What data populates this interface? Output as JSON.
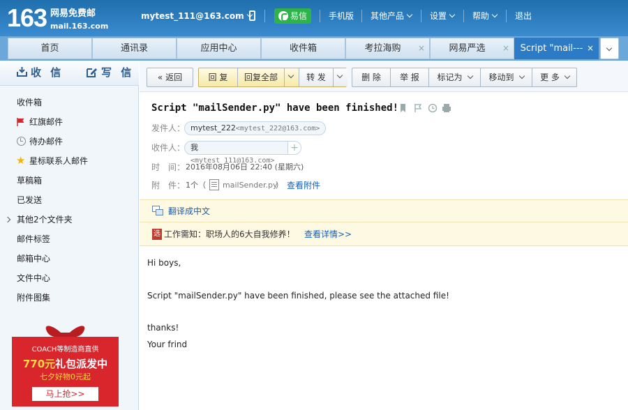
{
  "header": {
    "logo_number": "163",
    "logo_name": "网易免费邮",
    "logo_url": "mail.163.com",
    "account": "mytest_111@163.com",
    "yixin_label": "易信",
    "links": [
      "手机版",
      "其他产品",
      "设置",
      "帮助",
      "退出"
    ]
  },
  "tabs": [
    {
      "label": "首页",
      "closable": false,
      "active": false
    },
    {
      "label": "通讯录",
      "closable": false,
      "active": false
    },
    {
      "label": "应用中心",
      "closable": false,
      "active": false
    },
    {
      "label": "收件箱",
      "closable": false,
      "active": false
    },
    {
      "label": "考拉海购",
      "closable": true,
      "active": false
    },
    {
      "label": "网易严选",
      "closable": true,
      "active": false
    },
    {
      "label": "Script \"mail---",
      "closable": true,
      "active": true
    }
  ],
  "tab_close_glyph": "×",
  "sidebar": {
    "receive_label": "收 信",
    "write_label": "写 信",
    "items": [
      "收件箱",
      "红旗邮件",
      "待办邮件",
      "星标联系人邮件",
      "草稿箱",
      "已发送",
      "其他2个文件夹",
      "邮件标签",
      "邮箱中心",
      "文件中心",
      "附件图集"
    ]
  },
  "sidebar_ad": {
    "line1": "COACH等制造商直供",
    "amount": "770元",
    "line2_rest": "礼包派发中",
    "line3": "七夕好物0元起",
    "button": "马上抢>>"
  },
  "toolbar": {
    "back": "返回",
    "reply": "回 复",
    "reply_all": "回复全部",
    "forward": "转 发",
    "delete": "删 除",
    "report": "举 报",
    "mark_as": "标记为",
    "move_to": "移动到",
    "more": "更 多"
  },
  "mail": {
    "subject": "Script \"mailSender.py\" have been finished!",
    "from_label": "发件人：",
    "from_name": "mytest_222",
    "from_addr": "<mytest_222@163.com>",
    "to_label": "收件人：",
    "to_name": "我",
    "to_addr": "<mytest_111@163.com>",
    "time_label": "时　间：",
    "time_value": "2016年08月06日 22:40 (星期六)",
    "attach_label": "附　件：",
    "attach_count": "1个（",
    "attach_name": "mailSender.py",
    "attach_close": "）",
    "view_attach": "查看附件",
    "translate": "翻译成中文",
    "promo_text": "工作需知：职场人的6大自我修养！",
    "promo_link": "查看详情>>",
    "promo_badge": "选",
    "body": [
      "Hi boys,",
      "Script \"mailSender.py\" have been finished, please see the attached file!",
      "thanks!",
      "Your frind"
    ]
  },
  "colors": {
    "brand_blue": "#2d7bc4",
    "yixin_green": "#2eb34a",
    "ad_red": "#d8262c"
  },
  "icons": [
    "phone-icon",
    "inbox-icon",
    "write-icon",
    "flag-icon",
    "clock-icon",
    "star-icon",
    "bookmark-icon",
    "flag-outline-icon",
    "clock-outline-icon",
    "print-icon",
    "file-icon",
    "translate-icon"
  ]
}
